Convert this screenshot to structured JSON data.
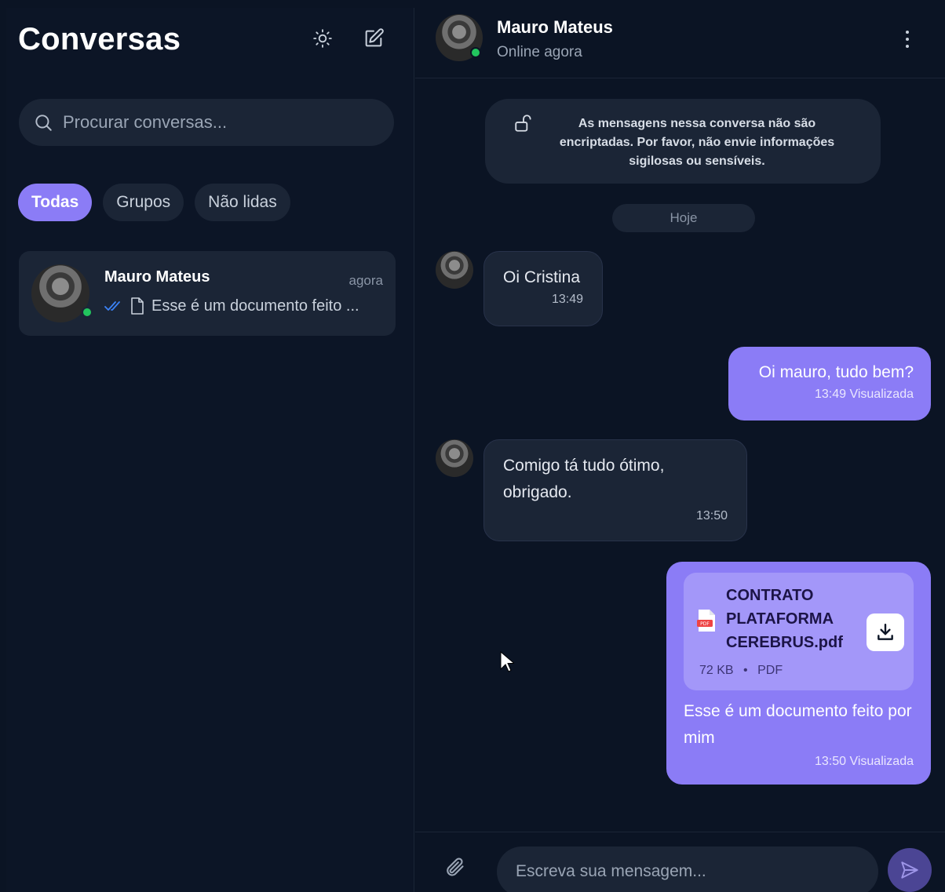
{
  "sidebar": {
    "title": "Conversas",
    "search_placeholder": "Procurar conversas...",
    "filters": [
      {
        "label": "Todas",
        "active": true
      },
      {
        "label": "Grupos",
        "active": false
      },
      {
        "label": "Não lidas",
        "active": false
      }
    ],
    "conversations": [
      {
        "name": "Mauro Mateus",
        "time": "agora",
        "preview": "Esse é um documento feito ...",
        "online": true,
        "status_icon": "double-check-icon",
        "preview_icon": "file-icon"
      }
    ],
    "icons": {
      "theme": "sun-icon",
      "compose": "edit-icon"
    }
  },
  "chat": {
    "contact_name": "Mauro Mateus",
    "contact_status": "Online agora",
    "encryption_notice": "As mensagens nessa conversa não são encriptadas. Por favor, não envie informações sigilosas ou sensíveis.",
    "date_separator": "Hoje",
    "messages": [
      {
        "direction": "in",
        "text": "Oi Cristina",
        "time": "13:49"
      },
      {
        "direction": "out",
        "text": "Oi mauro, tudo bem?",
        "time": "13:49 Visualizada"
      },
      {
        "direction": "in",
        "text": "Comigo tá tudo ótimo, obrigado.",
        "time": "13:50"
      },
      {
        "direction": "out",
        "attachment": {
          "file_name": "CONTRATO PLATAFORMA CEREBRUS.pdf",
          "size": "72 KB",
          "separator": "•",
          "type": "PDF"
        },
        "text": "Esse é um documento feito por mim",
        "time": "13:50 Visualizada"
      }
    ],
    "composer": {
      "placeholder": "Escreva sua mensagem..."
    }
  },
  "colors": {
    "background": "#0b1424",
    "surface": "#1b2536",
    "accent": "#8b7cf6",
    "online": "#22c55e"
  }
}
